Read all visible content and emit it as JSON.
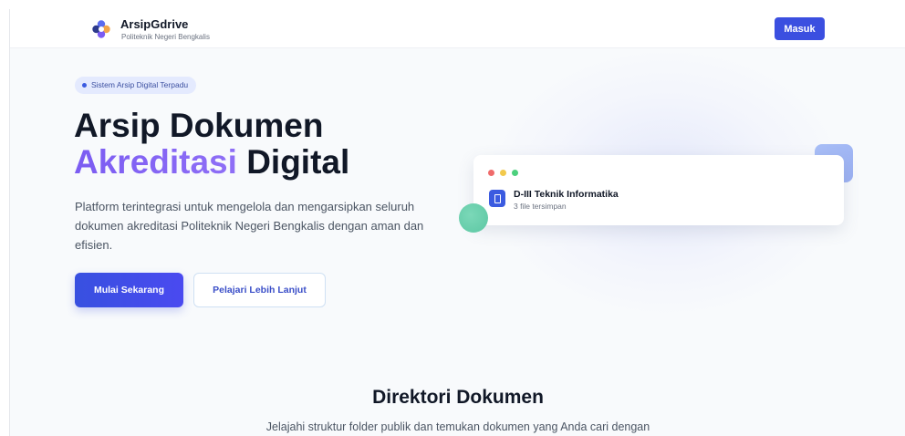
{
  "header": {
    "brand_title": "ArsipGdrive",
    "brand_subtitle": "Politeknik Negeri Bengkalis",
    "login_button": "Masuk",
    "logo_icon": "flower-logo-icon"
  },
  "hero": {
    "badge": "Sistem Arsip Digital Terpadu",
    "title_line1": "Arsip Dokumen",
    "title_accent": "Akreditasi",
    "title_line2_rest": " Digital",
    "description": "Platform terintegrasi untuk mengelola dan mengarsipkan seluruh dokumen akreditasi Politeknik Negeri Bengkalis dengan aman dan efisien.",
    "primary_button": "Mulai Sekarang",
    "secondary_button": "Pelajari Lebih Lanjut"
  },
  "preview_card": {
    "folder_name": "D-III Teknik Informatika",
    "file_count": "3 file tersimpan",
    "icon": "folder-icon"
  },
  "directory": {
    "title": "Direktori Dokumen",
    "subtitle": "Jelajahi struktur folder publik dan temukan dokumen yang Anda cari dengan"
  },
  "colors": {
    "primary": "#3b4fe0",
    "accent_purple": "#7b5cf2",
    "background": "#f8fafc",
    "text_dark": "#111827"
  }
}
